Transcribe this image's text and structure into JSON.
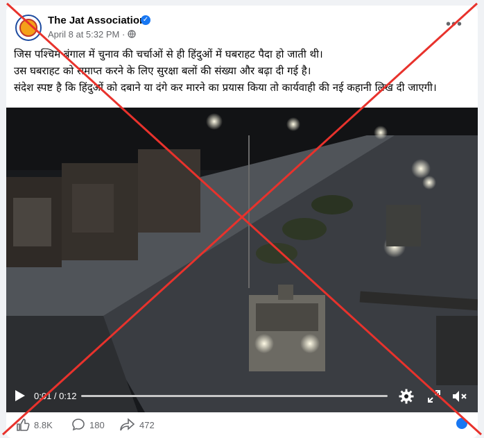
{
  "post": {
    "page_name": "The Jat Association",
    "date": "April 8 at 5:32 PM",
    "audience_icon": "globe-icon",
    "menu_icon": "more-options-icon",
    "text_lines": [
      "जिस पश्चिम बंगाल में चुनाव की चर्चाओं से ही हिंदुओं में घबराहट पैदा हो जाती थी।",
      "उस घबराहट को समाप्त करने के लिए सुरक्षा बलों की संख्या और बढ़ा दी गई है।",
      "संदेश स्पष्ट है कि हिंदुओं को दबाने या दंगे कर मारने का प्रयास किया तो कार्यवाही की नई कहानी लिख दी जाएगी।"
    ]
  },
  "video": {
    "time": "0:01 / 0:12",
    "progress": 0.0,
    "icons": [
      "play-icon",
      "settings-icon",
      "fullscreen-icon",
      "mute-icon"
    ]
  },
  "engagement": {
    "likes": "8.8K",
    "comments": "180",
    "shares": "472"
  },
  "colors": {
    "overlay_cross": "#e8322c",
    "verified": "#1877f2",
    "meta_text": "#65676b"
  }
}
